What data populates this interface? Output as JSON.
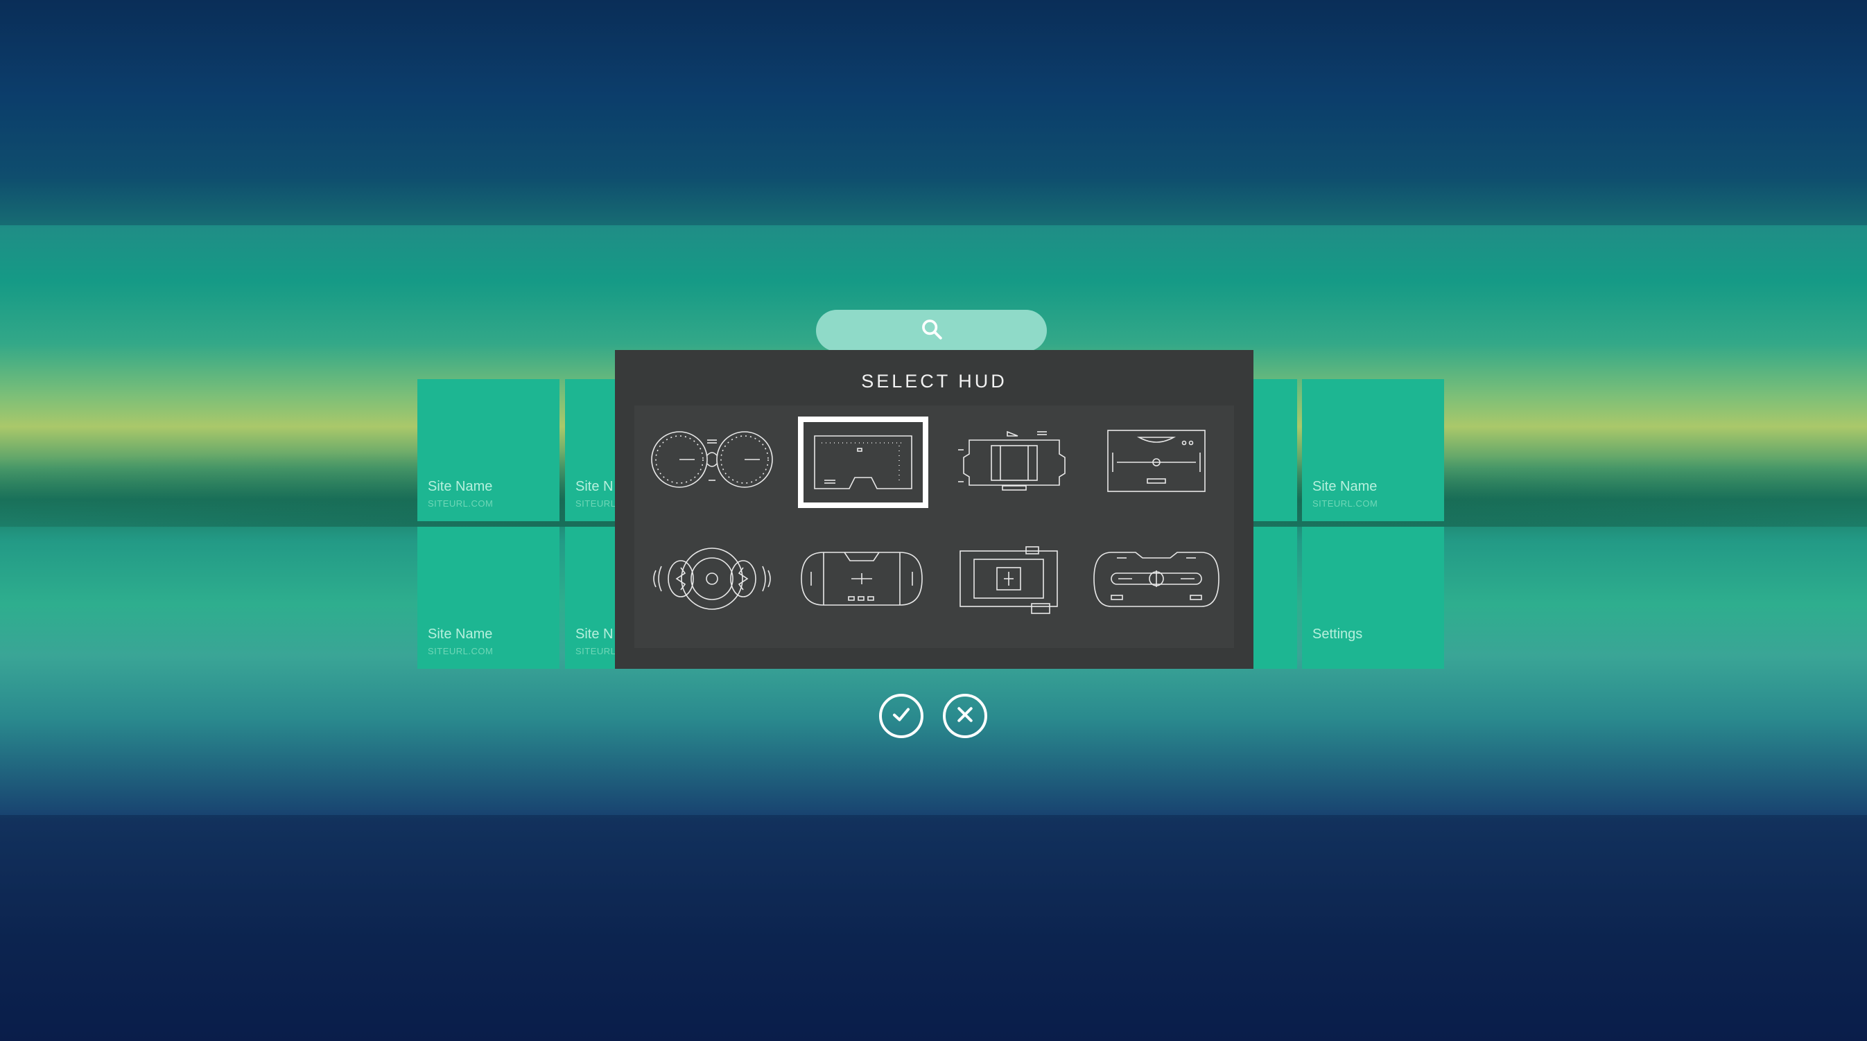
{
  "search": {
    "icon": "search-icon"
  },
  "tiles_left": [
    {
      "name": "Site Name",
      "url": "SITEURL.COM"
    },
    {
      "name": "Site N",
      "url": "SITEURL."
    },
    {
      "name": "Site Name",
      "url": "SITEURL.COM"
    },
    {
      "name": "Site N",
      "url": "SITEURL."
    }
  ],
  "tiles_right": [
    {
      "name": "Site Name",
      "url": "SITEURL.COM"
    },
    {
      "name": "Settings"
    }
  ],
  "modal": {
    "title": "SELECT HUD",
    "options": [
      {
        "id": "hud-dual-gauges",
        "selected": false
      },
      {
        "id": "hud-visor-frame",
        "selected": true
      },
      {
        "id": "hud-cockpit-panel",
        "selected": false
      },
      {
        "id": "hud-horizon-screen",
        "selected": false
      },
      {
        "id": "hud-round-cluster",
        "selected": false
      },
      {
        "id": "hud-capsule-console",
        "selected": false
      },
      {
        "id": "hud-target-box",
        "selected": false
      },
      {
        "id": "hud-controller-bar",
        "selected": false
      }
    ]
  },
  "actions": {
    "confirm": "check-icon",
    "cancel": "close-icon"
  },
  "colors": {
    "tile": "#1db692",
    "modal": "#383a3a",
    "search": "#8fdac8",
    "accent": "#ffffff"
  }
}
